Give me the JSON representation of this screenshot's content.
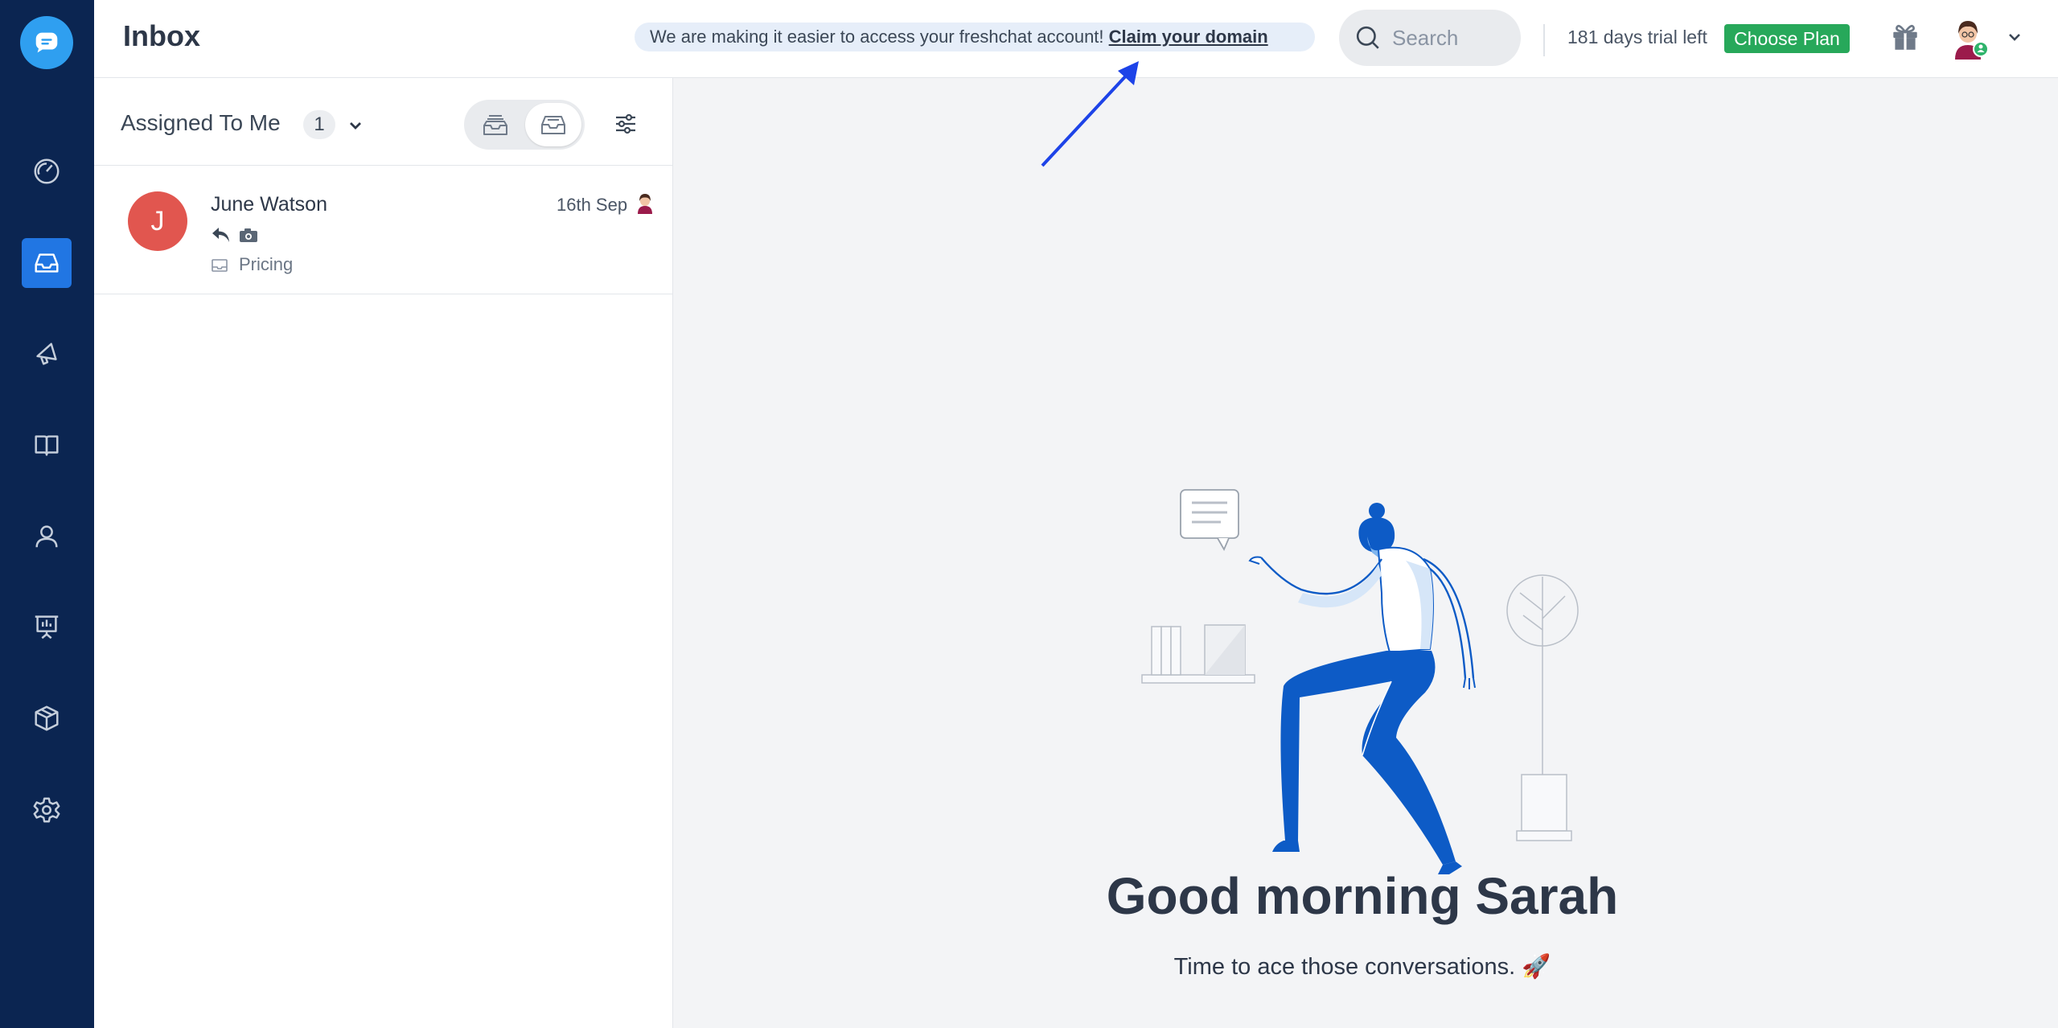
{
  "app": {
    "title": "Inbox"
  },
  "notice": {
    "text": "We are making it easier to access your freshchat account! ",
    "link": "Claim your domain"
  },
  "search": {
    "placeholder": "Search"
  },
  "trial": {
    "text": "181 days trial left",
    "cta": "Choose Plan"
  },
  "colors": {
    "rail": "#0b2551",
    "accent": "#2176e3",
    "cta_green": "#27a85a",
    "avatar_red": "#e1564f",
    "illustration_blue": "#0d5bc6"
  },
  "sidebar": {
    "items": [
      {
        "name": "dashboard",
        "icon": "speedometer-icon",
        "active": false
      },
      {
        "name": "inbox",
        "icon": "inbox-icon",
        "active": true
      },
      {
        "name": "campaigns",
        "icon": "megaphone-icon",
        "active": false
      },
      {
        "name": "solutions",
        "icon": "book-icon",
        "active": false
      },
      {
        "name": "contacts",
        "icon": "person-icon",
        "active": false
      },
      {
        "name": "reports",
        "icon": "presentation-chart-icon",
        "active": false
      },
      {
        "name": "integrations",
        "icon": "cube-icon",
        "active": false
      },
      {
        "name": "settings",
        "icon": "gear-icon",
        "active": false
      }
    ]
  },
  "list": {
    "filter_label": "Assigned To Me",
    "filter_count": "1",
    "conversations": [
      {
        "initial": "J",
        "name": "June Watson",
        "date": "16th Sep",
        "tag": "Pricing"
      }
    ]
  },
  "main": {
    "greeting": "Good morning Sarah",
    "subtext": "Time to ace those conversations. 🚀"
  }
}
